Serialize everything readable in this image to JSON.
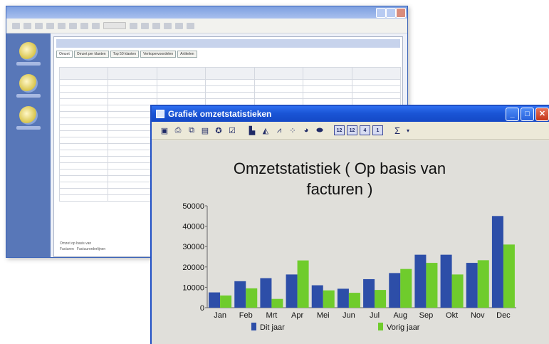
{
  "bg_window": {
    "tabs": [
      "Omzet",
      "Omzet per klanten",
      "Top 50 klanten",
      "Verkopervoordelen",
      "Artikelen"
    ],
    "table": {
      "rows": 20
    },
    "footer_line1": "Omzet op basis van",
    "footer_opt1": "Facturen",
    "footer_opt2": "Factuurorderlijnen"
  },
  "fg_window": {
    "title": "Grafiek omzetstatistieken",
    "toolbar_buttons": [
      "save-icon",
      "print-icon",
      "copy-icon",
      "export-icon",
      "wizard-icon",
      "properties-icon",
      "bar-chart-icon",
      "3d-bar-icon",
      "line-chart-icon",
      "scatter-icon",
      "pie-chart-icon",
      "doughnut-icon",
      "view-12-a-icon",
      "view-12-b-icon",
      "view-4-icon",
      "view-1-icon",
      "sum-icon",
      "dropdown-icon"
    ],
    "toolbar_labels": {
      "view12a": "12",
      "view12b": "12",
      "view4": "4",
      "view1": "1",
      "sum": "Σ"
    }
  },
  "chart_data": {
    "type": "bar",
    "title": "Omzetstatistiek ( Op basis van facturen )",
    "title_line1": "Omzetstatistiek ( Op basis van",
    "title_line2": "facturen )",
    "categories": [
      "Jan",
      "Feb",
      "Mrt",
      "Apr",
      "Mei",
      "Jun",
      "Jul",
      "Aug",
      "Sep",
      "Okt",
      "Nov",
      "Dec"
    ],
    "yticks": [
      "0",
      "10000",
      "20000",
      "30000",
      "40000",
      "50000"
    ],
    "ylim": [
      0,
      50000
    ],
    "series": [
      {
        "name": "Dit jaar",
        "color": "#2d4ea8",
        "values": [
          7500,
          13000,
          14500,
          16300,
          11000,
          9300,
          14000,
          17000,
          26000,
          26000,
          22000,
          45000
        ]
      },
      {
        "name": "Vorig jaar",
        "color": "#6fcc2c",
        "values": [
          6000,
          9500,
          4300,
          23200,
          8500,
          7300,
          8700,
          19000,
          22000,
          16300,
          23300,
          31000
        ]
      }
    ],
    "legend_position": "bottom",
    "grid": false
  }
}
